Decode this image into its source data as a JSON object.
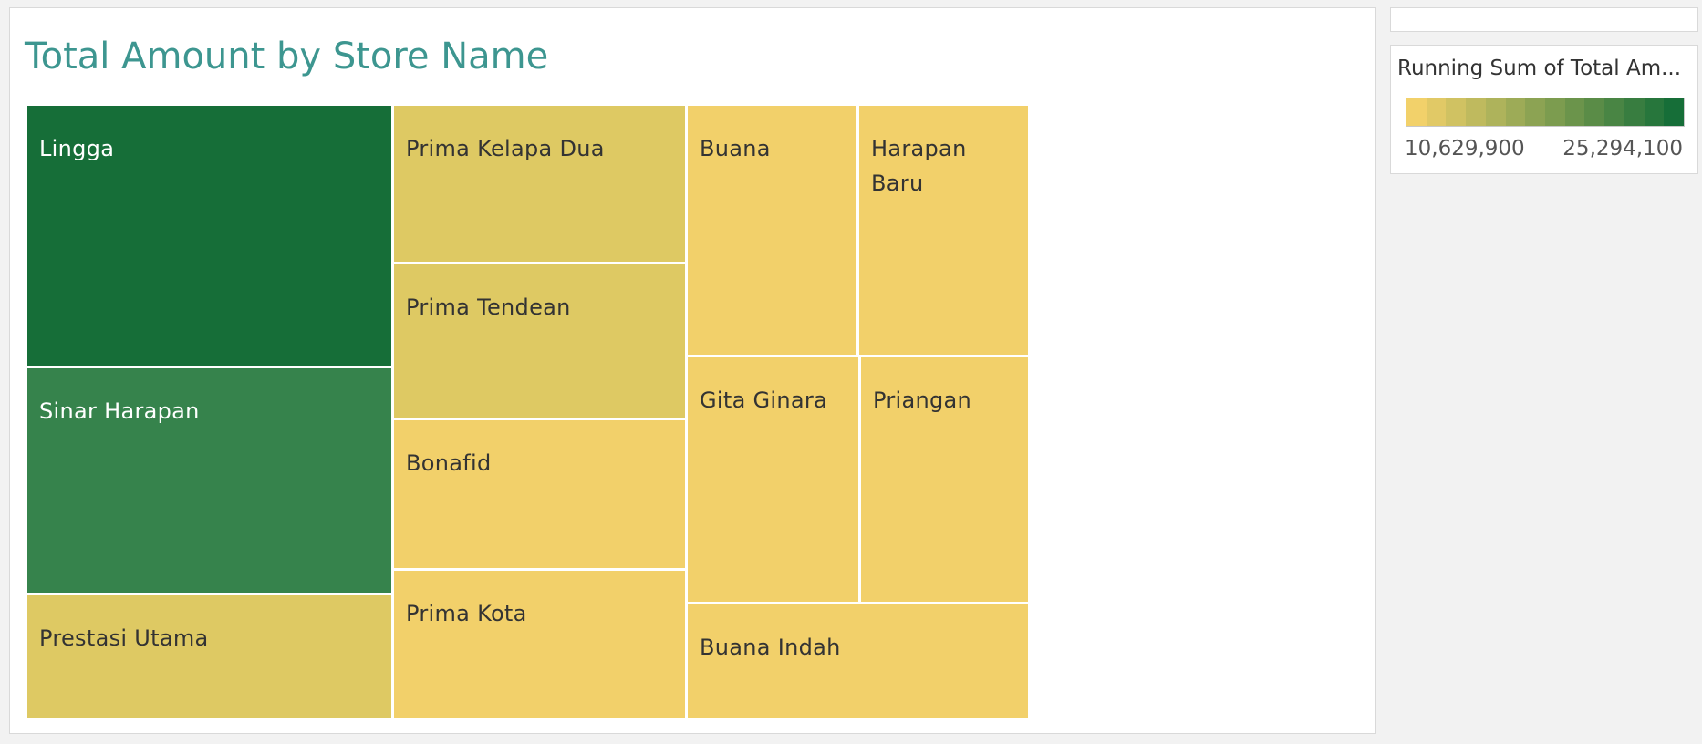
{
  "chart_data": {
    "type": "treemap",
    "title": "Total Amount by Store Name",
    "size_measure": "Total Amount",
    "color_measure": "Running Sum of Total Amount",
    "legend": {
      "title": "Running Sum of Total Am...",
      "min_label": "10,629,900",
      "max_label": "25,294,100",
      "min_value": 10629900,
      "max_value": 25294100,
      "color_low": "#f2d16a",
      "color_high": "#166e38",
      "steps": 14
    },
    "items": [
      {
        "name": "Lingga",
        "color": "#166e38"
      },
      {
        "name": "Sinar Harapan",
        "color": "#36834c"
      },
      {
        "name": "Prestasi Utama",
        "color": "#dec963"
      },
      {
        "name": "Prima Kelapa Dua",
        "color": "#dec963"
      },
      {
        "name": "Prima Tendean",
        "color": "#dec963"
      },
      {
        "name": "Bonafid",
        "color": "#f2d06a"
      },
      {
        "name": "Prima Kota",
        "color": "#f2d06a"
      },
      {
        "name": "Buana",
        "color": "#f2d06a"
      },
      {
        "name": "Harapan Baru",
        "color": "#f2d06a"
      },
      {
        "name": "Gita Ginara",
        "color": "#f2d06a"
      },
      {
        "name": "Priangan",
        "color": "#f2d06a"
      },
      {
        "name": "Buana Indah",
        "color": "#f2d06a"
      }
    ]
  }
}
